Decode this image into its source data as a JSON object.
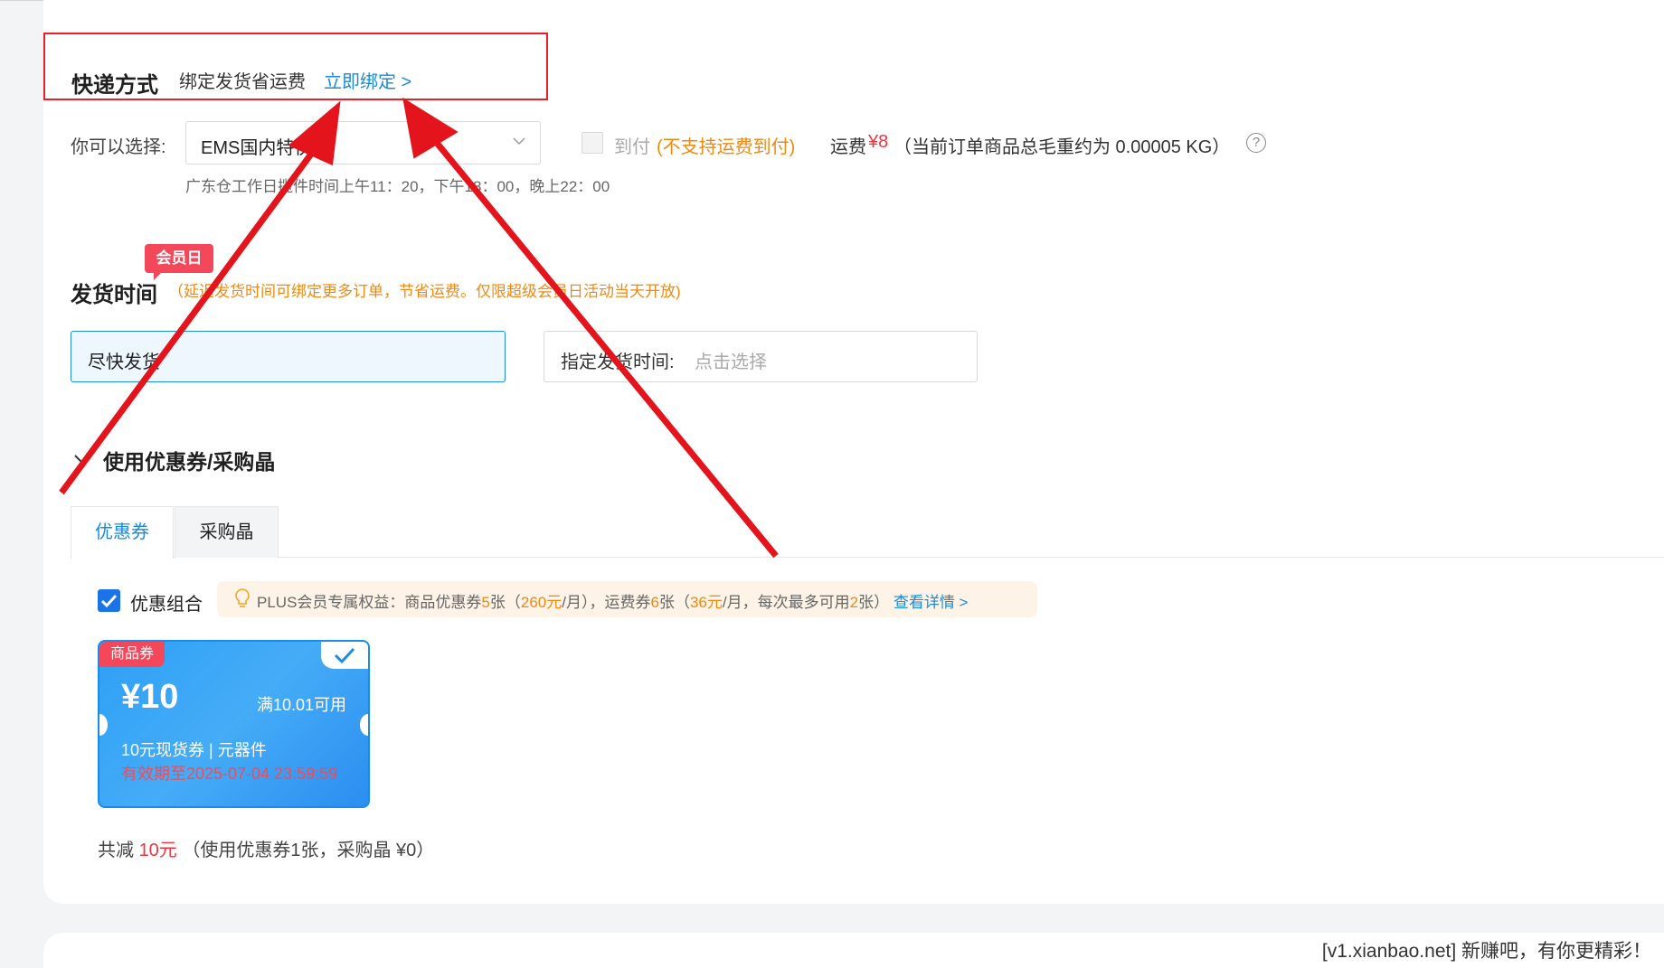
{
  "shipping": {
    "title": "快递方式",
    "bind_hint": "绑定发货省运费",
    "bind_link": "立即绑定 >",
    "choose_label": "你可以选择:",
    "selected_method": "EMS国内特快",
    "cod_label": "到付",
    "cod_note": "(不支持运费到付)",
    "fee_label": "运费",
    "fee_value": "¥8",
    "weight_note": "（当前订单商品总毛重约为 0.00005 KG）",
    "help_icon": "question-circle-icon",
    "warehouse_note": "广东仓工作日揽件时间上午11：20，下午18：00，晚上22：00"
  },
  "delivery": {
    "badge": "会员日",
    "title": "发货时间",
    "note": "（延迟发货时间可绑定更多订单，节省运费。仅限超级会员日活动当天开放)",
    "asap": "尽快发货",
    "scheduled_label": "指定发货时间:",
    "scheduled_placeholder": "点击选择"
  },
  "coupons": {
    "section_title": "使用优惠券/采购晶",
    "tabs": [
      {
        "label": "优惠券",
        "active": true
      },
      {
        "label": "采购晶",
        "active": false
      }
    ],
    "combo_label": "优惠组合",
    "combo_checked": true,
    "plus": {
      "icon": "lightbulb-icon",
      "prefix": "PLUS会员专属权益：商品优惠券",
      "goods_count": "5",
      "mid1": "张（",
      "goods_value": "260元",
      "mid2": "/月），运费券",
      "freight_count": "6",
      "mid3": "张（",
      "freight_value": "36元",
      "mid4": "/月，每次最多可用",
      "max_use": "2",
      "mid5": "张）",
      "link": "查看详情 >"
    },
    "card": {
      "tag": "商品券",
      "amount": "¥10",
      "condition": "满10.01可用",
      "description": "10元现货券 | 元器件",
      "expiry": "有效期至2025-07-04 23:59:59",
      "selected": true
    },
    "summary": {
      "prefix": "共减",
      "amount": "10元",
      "detail": "（使用优惠券1张，采购晶 ¥0）"
    }
  },
  "watermark": "[v1.xianbao.net] 新赚吧，有你更精彩！",
  "colors": {
    "accent_blue": "#1a8bd9",
    "highlight_red": "#e8202a",
    "price_red": "#f5333f",
    "warning_orange": "#ee8a11"
  }
}
